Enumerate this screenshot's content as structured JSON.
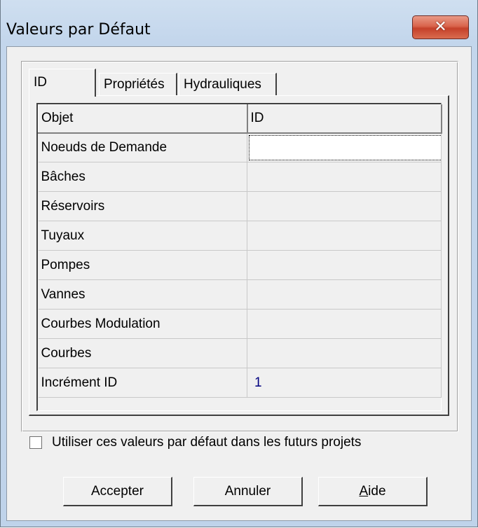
{
  "window": {
    "title": "Valeurs par Défaut",
    "close_glyph": "✕"
  },
  "tabs": [
    {
      "label": "ID",
      "active": true
    },
    {
      "label": "Propriétés",
      "active": false
    },
    {
      "label": "Hydrauliques",
      "active": false
    }
  ],
  "grid": {
    "headers": [
      "Objet",
      "ID"
    ],
    "rows": [
      {
        "object": "Noeuds de Demande",
        "id": ""
      },
      {
        "object": "Bâches",
        "id": ""
      },
      {
        "object": "Réservoirs",
        "id": ""
      },
      {
        "object": "Tuyaux",
        "id": ""
      },
      {
        "object": "Pompes",
        "id": ""
      },
      {
        "object": "Vannes",
        "id": ""
      },
      {
        "object": "Courbes Modulation",
        "id": ""
      },
      {
        "object": "Courbes",
        "id": ""
      },
      {
        "object": "Incrément ID",
        "id": "1"
      }
    ]
  },
  "checkbox": {
    "label": "Utiliser ces valeurs par défaut dans les futurs projets",
    "checked": false
  },
  "buttons": {
    "accept": "Accepter",
    "cancel": "Annuler",
    "help": "Aide"
  },
  "colors": {
    "value_text": "#000080",
    "close_button": "#c5412a"
  }
}
